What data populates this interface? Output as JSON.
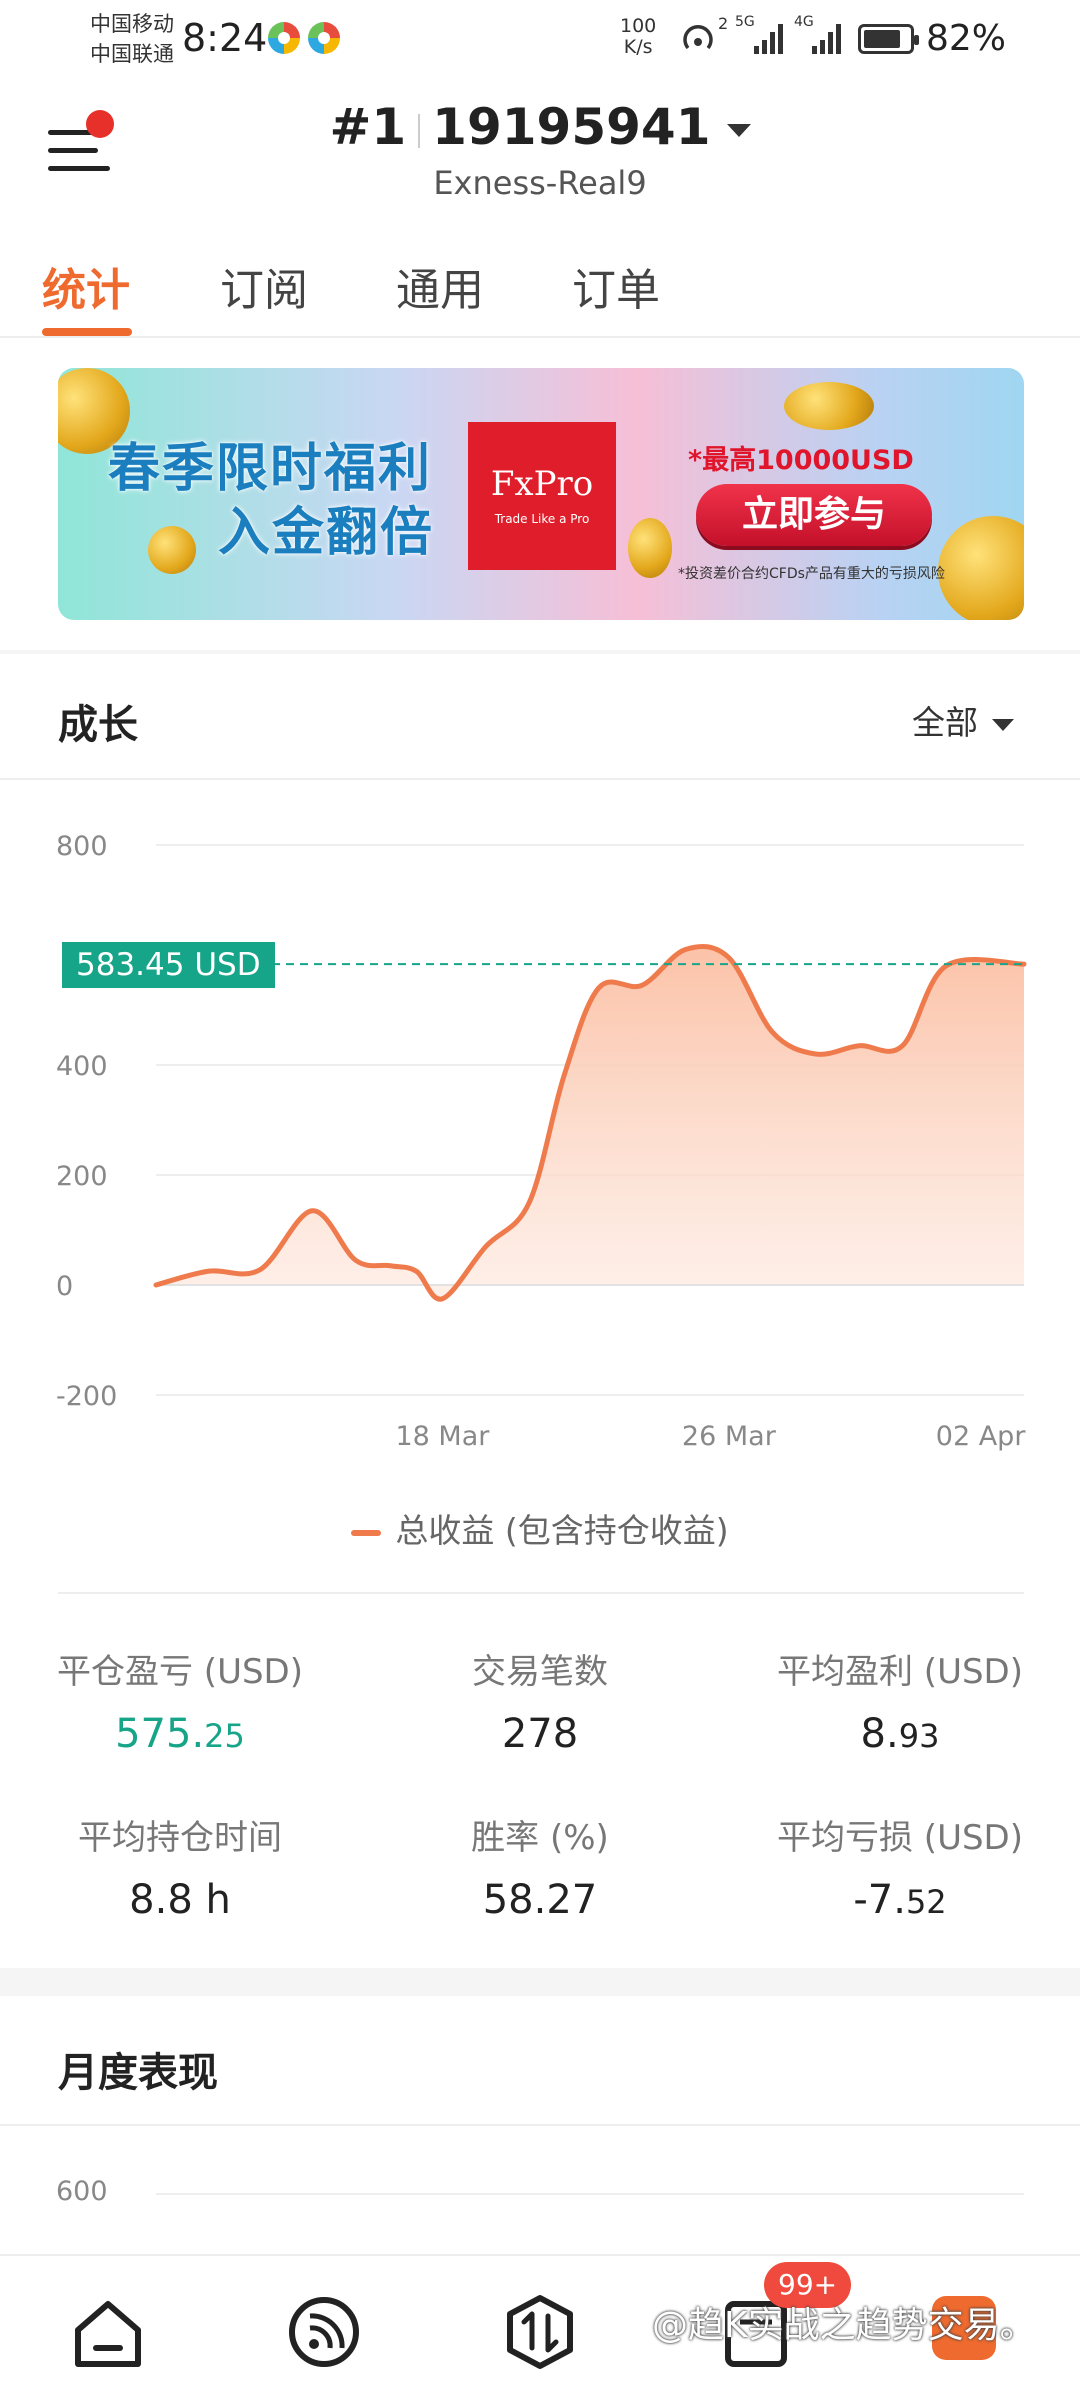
{
  "status_bar": {
    "carrier1": "中国移动",
    "carrier2": "中国联通",
    "time": "8:24",
    "net_speed_value": "100",
    "net_speed_unit": "K/s",
    "sig1": "2",
    "sig1_type": "5G",
    "sig2_type": "4G",
    "battery": "82%",
    "battery_level": 0.82
  },
  "header": {
    "account_index": "#1",
    "account_number": "19195941",
    "server": "Exness-Real9"
  },
  "tabs": [
    {
      "label": "统计",
      "active": true
    },
    {
      "label": "订阅",
      "active": false
    },
    {
      "label": "通用",
      "active": false
    },
    {
      "label": "订单",
      "active": false
    }
  ],
  "banner": {
    "title_line1": "春季限时福利",
    "title_line2": "入金翻倍",
    "brand": "FxPro",
    "brand_tagline": "Trade Like a Pro",
    "headline": "*最高10000USD",
    "cta": "立即参与",
    "disclaimer": "*投资差价合约CFDs产品有重大的亏损风险"
  },
  "growth": {
    "title": "成长",
    "range": "全部",
    "current_value": "583.45 USD",
    "legend": "总收益 (包含持仓收益)"
  },
  "chart_data": {
    "type": "area",
    "series": [
      {
        "name": "总收益 (包含持仓收益)",
        "color": "#ef7b4d",
        "fill": "#fcd0bd",
        "points": [
          [
            0,
            0
          ],
          [
            6,
            25
          ],
          [
            12,
            28
          ],
          [
            18,
            135
          ],
          [
            23,
            45
          ],
          [
            27,
            35
          ],
          [
            30,
            25
          ],
          [
            33,
            -25
          ],
          [
            38,
            70
          ],
          [
            43,
            150
          ],
          [
            47,
            380
          ],
          [
            51,
            540
          ],
          [
            56,
            545
          ],
          [
            61,
            610
          ],
          [
            66,
            595
          ],
          [
            71,
            460
          ],
          [
            76,
            420
          ],
          [
            81,
            435
          ],
          [
            86,
            435
          ],
          [
            91,
            580
          ],
          [
            100,
            583.45
          ]
        ]
      }
    ],
    "x_ticks": [
      "18 Mar",
      "26 Mar",
      "02 Apr"
    ],
    "x_tick_positions": [
      33,
      66,
      95
    ],
    "y_ticks": [
      "800",
      "400",
      "200",
      "0",
      "-200"
    ],
    "y_tick_values": [
      800,
      400,
      200,
      0,
      -200
    ],
    "ylim": [
      -200,
      800
    ],
    "reference_line": 583.45,
    "grid": true,
    "legend_position": "bottom"
  },
  "stats": [
    {
      "label": "平仓盈亏 (USD)",
      "int": "575.",
      "frac": "25",
      "color": "green"
    },
    {
      "label": "交易笔数",
      "int": "278",
      "frac": ""
    },
    {
      "label": "平均盈利 (USD)",
      "int": "8.",
      "frac": "93"
    },
    {
      "label": "平均持仓时间",
      "int": "8.8 h",
      "frac": ""
    },
    {
      "label": "胜率 (%)",
      "int": "58.27",
      "frac": ""
    },
    {
      "label": "平均亏损 (USD)",
      "int": "-7.",
      "frac": "52"
    }
  ],
  "monthly": {
    "title": "月度表现",
    "y_top": "600"
  },
  "bottom_nav": {
    "badge": "99+",
    "watermark": "@趋K实战之趋势交易。"
  },
  "colors": {
    "accent": "#ef6a2e",
    "positive": "#17a589",
    "series": "#ef7b4d"
  }
}
